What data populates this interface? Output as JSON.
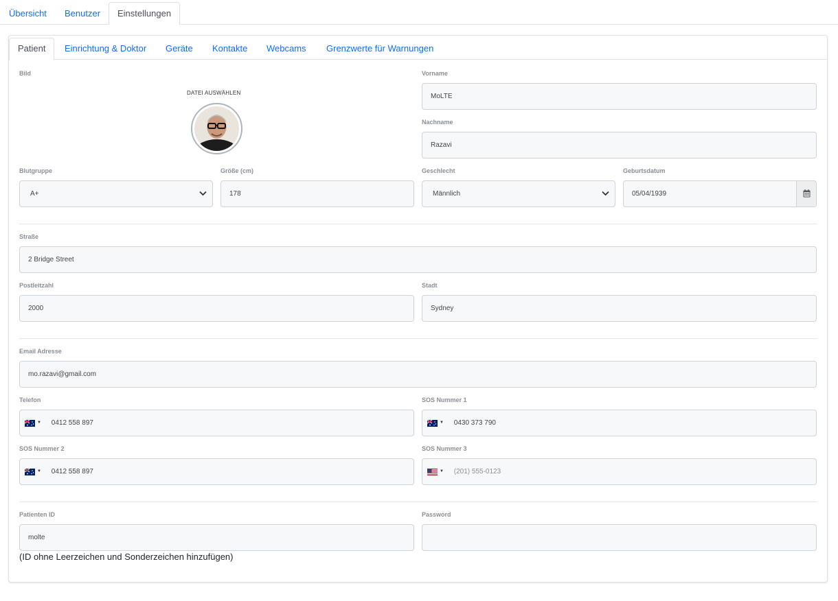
{
  "top_tabs": [
    "Übersicht",
    "Benutzer",
    "Einstellungen"
  ],
  "inner_tabs": [
    "Patient",
    "Einrichtung & Doktor",
    "Geräte",
    "Kontakte",
    "Webcams",
    "Grenzwerte für Warnungen"
  ],
  "form": {
    "image_label": "Bild",
    "upload_label": "DATEI AUSWÄHLEN",
    "first_name": {
      "label": "Vorname",
      "value": "MoLTE"
    },
    "last_name": {
      "label": "Nachname",
      "value": "Razavi"
    },
    "blood_group": {
      "label": "Blutgruppe",
      "value": "A+"
    },
    "height": {
      "label": "Größe (cm)",
      "value": "178"
    },
    "gender": {
      "label": "Geschlecht",
      "value": "Männlich"
    },
    "birthdate": {
      "label": "Geburtsdatum",
      "value": "05/04/1939"
    },
    "street": {
      "label": "Straße",
      "value": "2 Bridge Street"
    },
    "postcode": {
      "label": "Postleitzahl",
      "value": "2000"
    },
    "city": {
      "label": "Stadt",
      "value": "Sydney"
    },
    "email": {
      "label": "Email Adresse",
      "value": "mo.razavi@gmail.com"
    },
    "phone": {
      "label": "Telefon",
      "value": "0412 558 897",
      "flag": "AU"
    },
    "sos1": {
      "label": "SOS Nummer 1",
      "value": "0430 373 790",
      "flag": "AU"
    },
    "sos2": {
      "label": "SOS Nummer 2",
      "value": "0412 558 897",
      "flag": "AU"
    },
    "sos3": {
      "label": "SOS Nummer 3",
      "placeholder": "(201) 555-0123",
      "flag": "US"
    },
    "patient_id": {
      "label": "Patienten ID",
      "value": "molte"
    },
    "password": {
      "label": "Password",
      "value": ""
    },
    "id_hint": "(ID ohne Leerzeichen und Sonderzeichen hinzufügen)"
  },
  "icons": {
    "avatar": "user-photo",
    "calendar": "calendar-icon",
    "chevron": "chevron-down-icon"
  },
  "colors": {
    "link": "#0d6efd",
    "field_bg": "#f7f8f9",
    "label": "#8a8f96"
  }
}
